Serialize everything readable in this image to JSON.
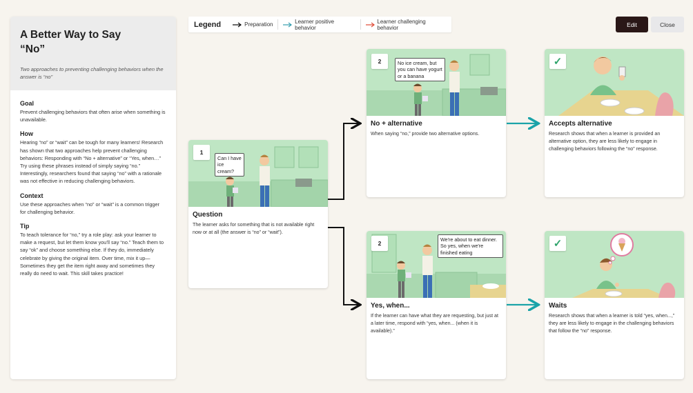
{
  "sidebar": {
    "title_line1": "A Better Way to Say",
    "title_line2": "“No”",
    "subtitle": "Two approaches to preventing challenging behaviors when the answer is “no”",
    "sections": [
      {
        "heading": "Goal",
        "text": "Prevent challenging behaviors that often arise when something is unavailable."
      },
      {
        "heading": "How",
        "text": "Hearing “no” or “wait” can be tough for many learners! Research has shown that two approaches help prevent challenging behaviors: Responding with “No + alternative” or “Yes, when…” Try using these phrases instead of simply saying “no.” Interestingly, researchers found that saying “no” with a rationale was not effective in reducing challenging behaviors."
      },
      {
        "heading": "Context",
        "text": "Use these approaches when “no” or “wait” is a common trigger for challenging behavior."
      },
      {
        "heading": "Tip",
        "text": "To teach tolerance for “no,” try a role play: ask your learner to make a request, but let them know you'll say “no.” Teach them to say “ok” and choose something else. If they do, immediately celebrate by giving the original item. Over time, mix it up— Sometimes they get the item right away and sometimes they really do need to wait. This skill takes practice!"
      }
    ]
  },
  "legend": {
    "title": "Legend",
    "items": [
      {
        "label": "Preparation",
        "color": "#111111"
      },
      {
        "label": "Learner positive behavior",
        "color": "#3aa0b0"
      },
      {
        "label": "Learner challenging behavior",
        "color": "#e0503c"
      }
    ]
  },
  "buttons": {
    "edit": "Edit",
    "close": "Close"
  },
  "cards": {
    "question": {
      "badge": "1",
      "bubble": "Can I have ice cream?",
      "title": "Question",
      "desc": "The learner asks for something that is not available right now or at all (the answer is “no” or “wait”)."
    },
    "no_alt": {
      "badge": "2",
      "bubble": "No ice cream, but you can have yogurt or a banana",
      "title": "No + alternative",
      "desc": "When saying “no,” provide two alternative options."
    },
    "yes_when": {
      "badge": "2",
      "bubble": "We're about to eat dinner. So yes, when we're finished eating",
      "title": "Yes, when...",
      "desc": "If the learner can have what they are requesting, but just at a later time, respond with “yes, when... (when it is available).”"
    },
    "accepts": {
      "badge": "✓",
      "title": "Accepts alternative",
      "desc": "Research shows that when a learner is provided an alternative option, they are less likely to engage in challenging behaviors following the “no” response."
    },
    "waits": {
      "badge": "✓",
      "title": "Waits",
      "desc": "Research shows that when a learner is told “yes, when...,” they are less likely to engage in the challenging behaviors that follow the “no” response."
    }
  },
  "colors": {
    "panel_green": "#bfe6c4",
    "positive_arrow": "#1aa3a8",
    "prep_arrow": "#111111",
    "edit_bg": "#2a1717"
  },
  "icons": [
    "checkmark-icon",
    "arrow-right-icon"
  ]
}
